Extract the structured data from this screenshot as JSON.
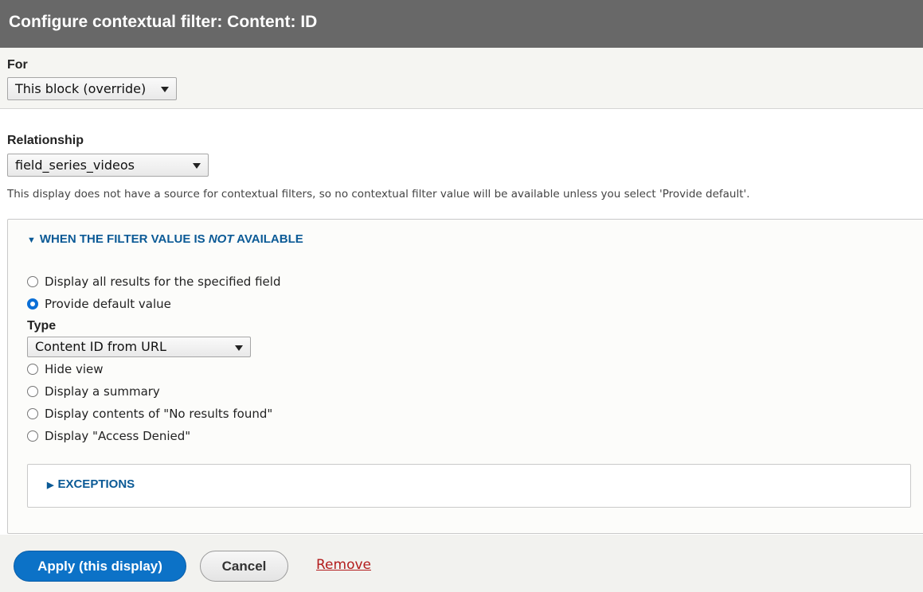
{
  "dialog": {
    "title": "Configure contextual filter: Content: ID"
  },
  "for_field": {
    "label": "For",
    "selected": "This block (override)"
  },
  "relationship": {
    "label": "Relationship",
    "selected": "field_series_videos",
    "description": "This display does not have a source for contextual filters, so no contextual filter value will be available unless you select 'Provide default'."
  },
  "not_available": {
    "summary_prefix": "WHEN THE FILTER VALUE IS ",
    "summary_emphasis": "NOT",
    "summary_suffix": " AVAILABLE",
    "options": [
      {
        "label": "Display all results for the specified field",
        "checked": false
      },
      {
        "label": "Provide default value",
        "checked": true
      }
    ],
    "type": {
      "label": "Type",
      "selected": "Content ID from URL"
    },
    "more_options": [
      {
        "label": "Hide view",
        "checked": false
      },
      {
        "label": "Display a summary",
        "checked": false
      },
      {
        "label": "Display contents of \"No results found\"",
        "checked": false
      },
      {
        "label": "Display \"Access Denied\"",
        "checked": false
      }
    ],
    "exceptions_label": "EXCEPTIONS"
  },
  "actions": {
    "apply": "Apply (this display)",
    "cancel": "Cancel",
    "remove": "Remove"
  },
  "colors": {
    "titlebar": "#686868",
    "primary": "#0c72c7",
    "link": "#0b5a96",
    "remove": "#b31c1c"
  }
}
